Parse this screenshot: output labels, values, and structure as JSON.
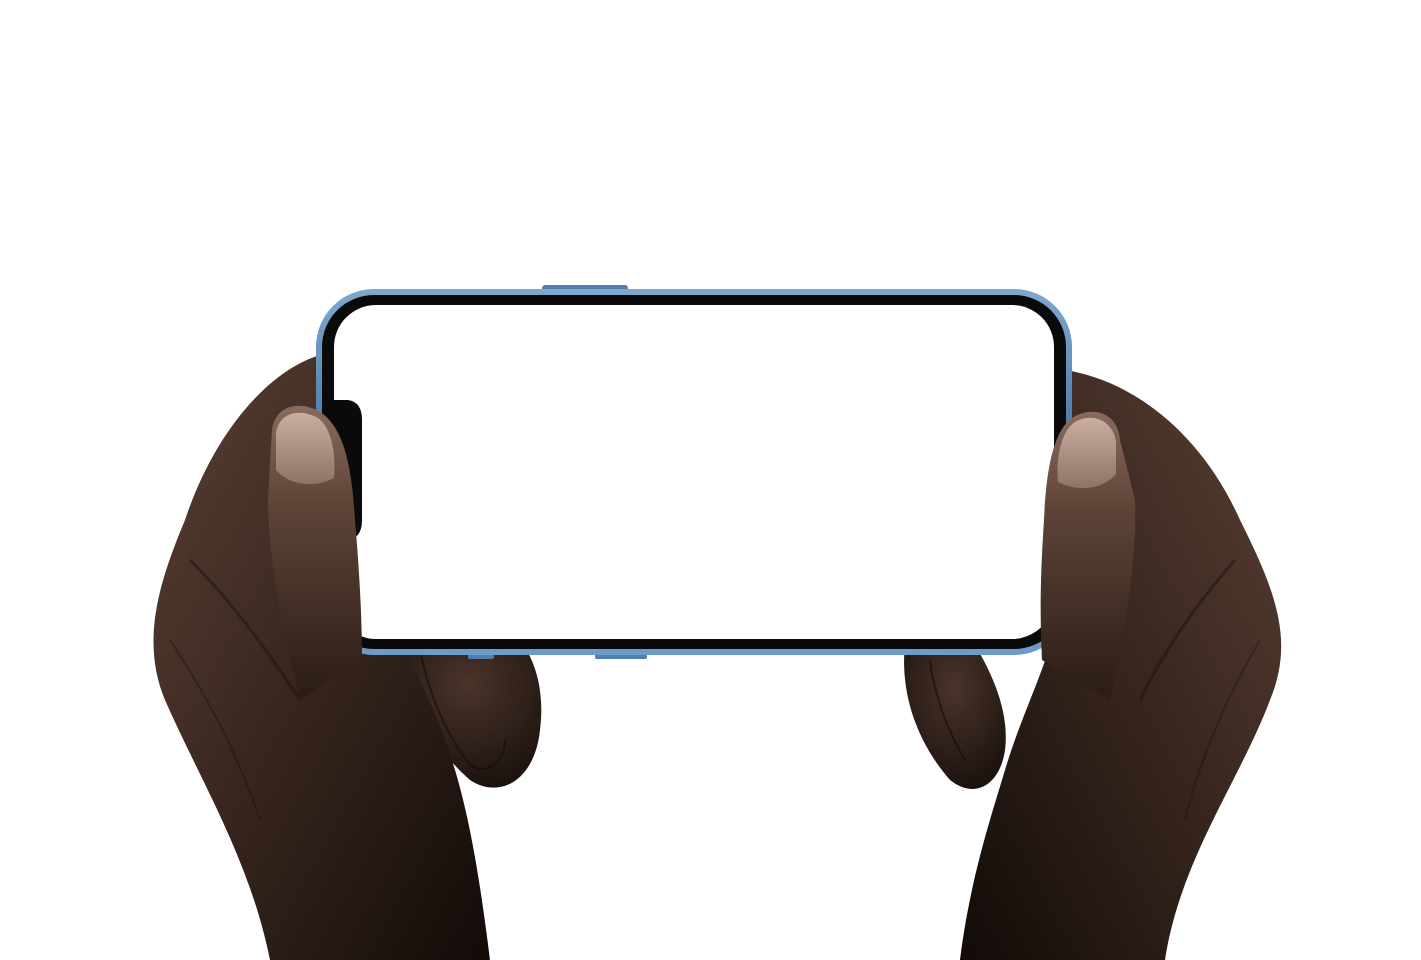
{
  "scene": {
    "background_color": "#ffffff",
    "subject": "phone-held-landscape-by-two-hands",
    "phone": {
      "frame_color": "#3f6f9e",
      "frame_highlight_color": "#7fa8cf",
      "bezel_color": "#0a0a0a",
      "screen_color": "#ffffff",
      "screen_content": "blank",
      "notch": "left-side"
    },
    "hands": {
      "skin_color": "#3a2820",
      "skin_shadow_color": "#1a110d",
      "nail_color": "#b79a8c"
    }
  }
}
